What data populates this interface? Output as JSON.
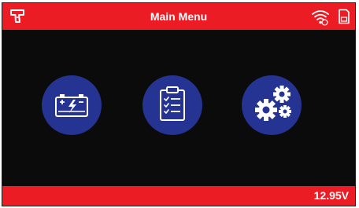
{
  "header": {
    "title": "Main Menu",
    "left_icon": "scan-gun-icon",
    "right_icons": [
      "wifi-icon",
      "sd-card-icon"
    ]
  },
  "menu": {
    "items": [
      {
        "icon": "battery-test-icon",
        "color": "#253493"
      },
      {
        "icon": "clipboard-checklist-icon",
        "color": "#253493"
      },
      {
        "icon": "gears-settings-icon",
        "color": "#253493"
      }
    ]
  },
  "footer": {
    "voltage": "12.95V"
  },
  "colors": {
    "accent_red": "#ec1c24",
    "button_blue": "#253493",
    "background": "#0b0b0b"
  }
}
